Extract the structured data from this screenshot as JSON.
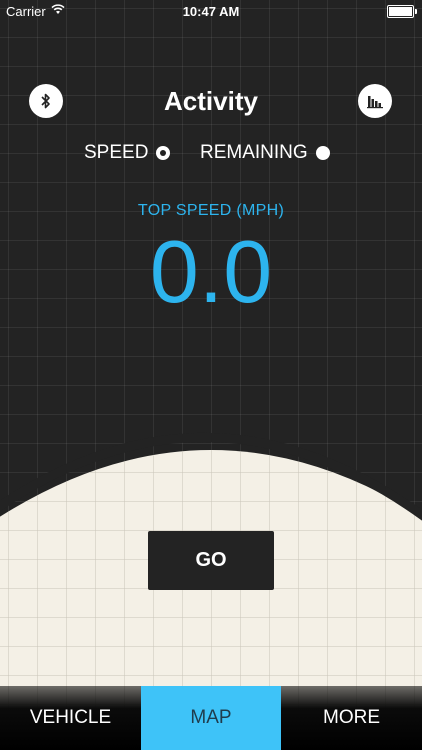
{
  "status_bar": {
    "carrier": "Carrier",
    "time": "10:47 AM"
  },
  "header": {
    "title": "Activity",
    "left_icon": "bluetooth-icon",
    "right_icon": "bar-chart-icon"
  },
  "mode_toggle": {
    "options": [
      {
        "label": "SPEED",
        "selected": true
      },
      {
        "label": "REMAINING",
        "selected": false
      }
    ]
  },
  "metric": {
    "label": "TOP SPEED (MPH)",
    "value": "0.0"
  },
  "go_button": {
    "label": "GO"
  },
  "tab_bar": {
    "tabs": [
      {
        "label": "VEHICLE",
        "active": false
      },
      {
        "label": "MAP",
        "active": true
      },
      {
        "label": "MORE",
        "active": false
      }
    ]
  },
  "colors": {
    "background": "#232323",
    "accent_blue": "#2db4ee",
    "tab_active": "#3ec3f8",
    "cream": "#f4f0e6"
  }
}
